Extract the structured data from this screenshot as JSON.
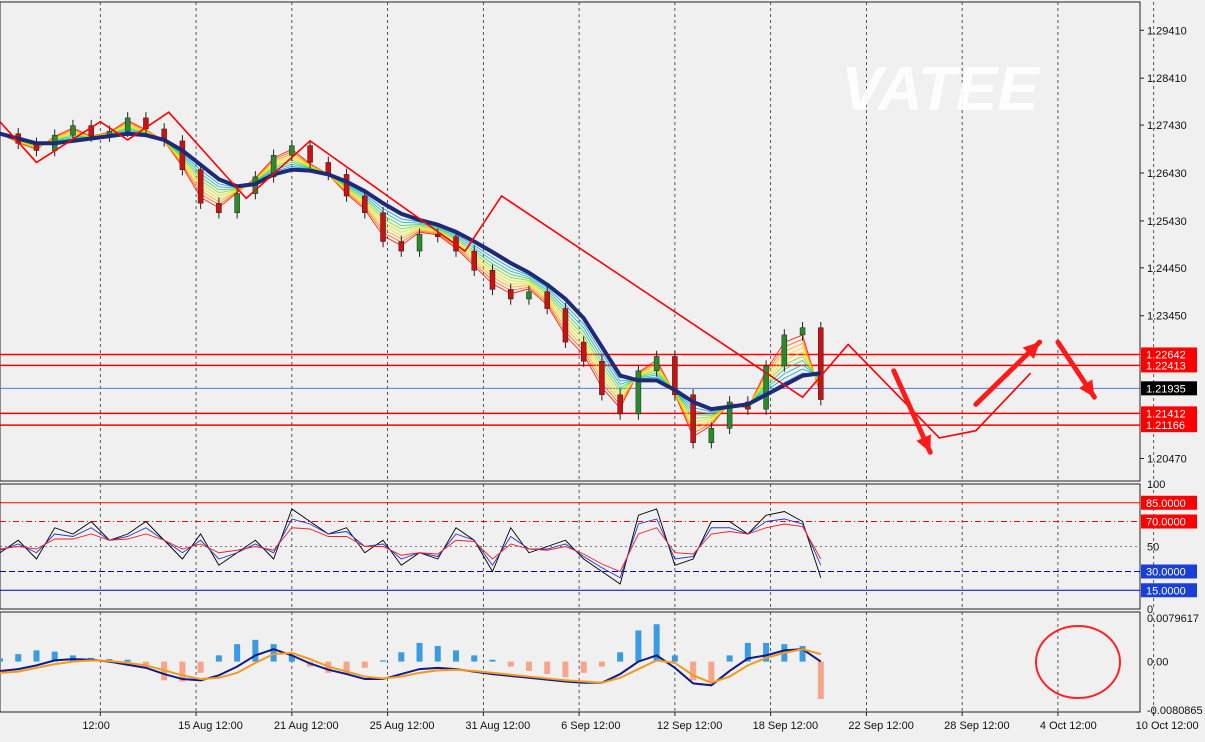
{
  "watermark": "VATEE",
  "chart_data": [
    {
      "type": "line",
      "panel": "price",
      "ylim": [
        1.2,
        1.3
      ],
      "y_ticks": [
        "1.29410",
        "1.28410",
        "1.27430",
        "1.26430",
        "1.25430",
        "1.24450",
        "1.23450",
        "1.20470"
      ],
      "current_price": "1.21935",
      "level_lines": [
        "1.22642",
        "1.22413",
        "1.21412",
        "1.21166"
      ],
      "x": [
        0,
        4,
        8,
        12,
        16,
        20,
        24,
        28,
        32,
        36,
        40,
        44,
        48,
        52,
        56,
        60,
        64,
        68,
        72,
        76,
        80,
        84,
        88,
        92,
        96,
        100,
        104,
        108,
        112,
        116,
        120,
        124,
        128,
        132,
        136,
        140,
        144,
        148,
        152,
        156,
        160,
        164,
        168,
        172,
        176,
        180
      ],
      "close": [
        1.2725,
        1.2705,
        1.269,
        1.2722,
        1.2742,
        1.272,
        1.273,
        1.2758,
        1.2735,
        1.271,
        1.265,
        1.258,
        1.256,
        1.26,
        1.2635,
        1.268,
        1.27,
        1.2665,
        1.264,
        1.2595,
        1.256,
        1.25,
        1.248,
        1.2515,
        1.251,
        1.248,
        1.244,
        1.24,
        1.238,
        1.2395,
        1.236,
        1.229,
        1.225,
        1.218,
        1.214,
        1.223,
        1.226,
        1.218,
        1.208,
        1.211,
        1.2165,
        1.215,
        1.224,
        1.2305,
        1.232,
        1.217
      ],
      "ma": [
        1.2725,
        1.2715,
        1.2705,
        1.2705,
        1.271,
        1.2715,
        1.272,
        1.2725,
        1.2722,
        1.2712,
        1.269,
        1.266,
        1.263,
        1.2615,
        1.262,
        1.264,
        1.265,
        1.2648,
        1.264,
        1.2625,
        1.2605,
        1.258,
        1.2558,
        1.2545,
        1.2535,
        1.252,
        1.25,
        1.2478,
        1.2455,
        1.2435,
        1.241,
        1.238,
        1.234,
        1.228,
        1.222,
        1.221,
        1.221,
        1.219,
        1.2165,
        1.215,
        1.2155,
        1.216,
        1.218,
        1.22,
        1.222,
        1.2225
      ],
      "zigzag": [
        [
          0,
          1.275
        ],
        [
          8,
          1.2665
        ],
        [
          22,
          1.275
        ],
        [
          28,
          1.2712
        ],
        [
          37,
          1.277
        ],
        [
          54,
          1.259
        ],
        [
          68,
          1.271
        ],
        [
          102,
          1.248
        ],
        [
          110,
          1.2595
        ],
        [
          176,
          1.2175
        ],
        [
          186,
          1.2285
        ],
        [
          206,
          1.209
        ],
        [
          214,
          1.2105
        ],
        [
          226,
          1.2225
        ]
      ],
      "arrows": [
        [
          [
            196,
            1.223
          ],
          [
            204,
            1.206
          ]
        ],
        [
          [
            214,
            1.216
          ],
          [
            228,
            1.229
          ]
        ],
        [
          [
            232,
            1.229
          ],
          [
            240,
            1.2175
          ]
        ]
      ]
    },
    {
      "type": "line",
      "panel": "oscillator",
      "ylim": [
        0,
        100
      ],
      "y_ticks": [
        "100",
        "50",
        "0"
      ],
      "levels": [
        "85.0000",
        "70.0000",
        "30.0000",
        "15.0000"
      ],
      "x": [
        0,
        4,
        8,
        12,
        16,
        20,
        24,
        28,
        32,
        36,
        40,
        44,
        48,
        52,
        56,
        60,
        64,
        68,
        72,
        76,
        80,
        84,
        88,
        92,
        96,
        100,
        104,
        108,
        112,
        116,
        120,
        124,
        128,
        132,
        136,
        140,
        144,
        148,
        152,
        156,
        160,
        164,
        168,
        172,
        176,
        180
      ],
      "series": [
        {
          "values": [
            45,
            55,
            40,
            65,
            60,
            70,
            55,
            60,
            70,
            55,
            40,
            60,
            35,
            45,
            55,
            40,
            80,
            70,
            60,
            65,
            45,
            55,
            35,
            45,
            40,
            65,
            55,
            30,
            65,
            45,
            50,
            55,
            40,
            30,
            20,
            75,
            80,
            35,
            40,
            70,
            70,
            60,
            75,
            78,
            70,
            25
          ]
        },
        {
          "values": [
            47,
            52,
            45,
            60,
            58,
            65,
            55,
            58,
            65,
            55,
            45,
            55,
            40,
            45,
            52,
            45,
            72,
            68,
            60,
            62,
            50,
            52,
            40,
            45,
            42,
            60,
            55,
            35,
            58,
            48,
            48,
            52,
            42,
            33,
            25,
            68,
            72,
            40,
            42,
            65,
            65,
            60,
            70,
            72,
            68,
            35
          ]
        },
        {
          "values": [
            48,
            50,
            48,
            56,
            56,
            60,
            55,
            56,
            60,
            55,
            48,
            52,
            45,
            47,
            50,
            47,
            65,
            64,
            58,
            58,
            50,
            50,
            43,
            45,
            44,
            55,
            54,
            40,
            52,
            48,
            47,
            50,
            44,
            36,
            30,
            60,
            65,
            45,
            44,
            60,
            62,
            60,
            65,
            68,
            66,
            40
          ]
        }
      ]
    },
    {
      "type": "bar",
      "panel": "macd",
      "ylim": [
        -0.0080865,
        0.0079617
      ],
      "y_ticks": [
        "0.0079617",
        "0.00",
        "-0.0080865"
      ],
      "x_labels": [
        "12:00",
        "15 Aug 12:00",
        "21 Aug 12:00",
        "25 Aug 12:00",
        "31 Aug 12:00",
        "6 Sep 12:00",
        "12 Sep 12:00",
        "18 Sep 12:00",
        "22 Sep 12:00",
        "28 Sep 12:00",
        "4 Oct 12:00",
        "10 Oct 12:00"
      ],
      "x": [
        0,
        4,
        8,
        12,
        16,
        20,
        24,
        28,
        32,
        36,
        40,
        44,
        48,
        52,
        56,
        60,
        64,
        68,
        72,
        76,
        80,
        84,
        88,
        92,
        96,
        100,
        104,
        108,
        112,
        116,
        120,
        124,
        128,
        132,
        136,
        140,
        144,
        148,
        152,
        156,
        160,
        164,
        168,
        172,
        176,
        180
      ],
      "histogram": [
        0.0005,
        0.0012,
        0.0018,
        0.0016,
        0.001,
        0.0006,
        0.0004,
        0.0003,
        -0.001,
        -0.003,
        -0.0032,
        -0.0018,
        0.001,
        0.0028,
        0.0035,
        0.0028,
        0.001,
        -0.0008,
        -0.0018,
        -0.002,
        -0.001,
        0.0002,
        0.0015,
        0.003,
        0.0025,
        0.0018,
        0.001,
        0.0003,
        -0.0008,
        -0.0015,
        -0.002,
        -0.0025,
        -0.0018,
        -0.0008,
        0.0015,
        0.005,
        0.006,
        0.001,
        -0.003,
        -0.0035,
        0.001,
        0.003,
        0.003,
        0.0028,
        0.0025,
        -0.006
      ],
      "series": [
        {
          "values": [
            -0.0015,
            -0.0012,
            -0.0006,
            0.0002,
            0.0004,
            0.0003,
            0.0,
            -0.0005,
            -0.001,
            -0.002,
            -0.0028,
            -0.003,
            -0.0022,
            -0.0008,
            0.001,
            0.002,
            0.001,
            -0.0003,
            -0.0013,
            -0.002,
            -0.0028,
            -0.0028,
            -0.002,
            -0.0012,
            -0.001,
            -0.0012,
            -0.0016,
            -0.002,
            -0.0023,
            -0.0026,
            -0.0029,
            -0.0032,
            -0.0034,
            -0.0034,
            -0.002,
            0.0,
            0.001,
            -0.001,
            -0.0035,
            -0.0038,
            -0.0015,
            0.0005,
            0.001,
            0.0018,
            0.002,
            0.0
          ]
        },
        {
          "values": [
            -0.0018,
            -0.0016,
            -0.001,
            -0.0004,
            0.0,
            0.0002,
            0.0001,
            -0.0002,
            -0.0006,
            -0.0014,
            -0.0022,
            -0.0028,
            -0.0026,
            -0.0018,
            -0.0002,
            0.0012,
            0.0014,
            0.0004,
            -0.0008,
            -0.0016,
            -0.0024,
            -0.0027,
            -0.0024,
            -0.0018,
            -0.0014,
            -0.0013,
            -0.0015,
            -0.0018,
            -0.0021,
            -0.0024,
            -0.0027,
            -0.003,
            -0.0032,
            -0.0034,
            -0.0026,
            -0.0012,
            0.0002,
            -0.0002,
            -0.0022,
            -0.0034,
            -0.0024,
            -0.0006,
            0.0006,
            0.0014,
            0.002,
            0.0012
          ]
        }
      ]
    }
  ]
}
